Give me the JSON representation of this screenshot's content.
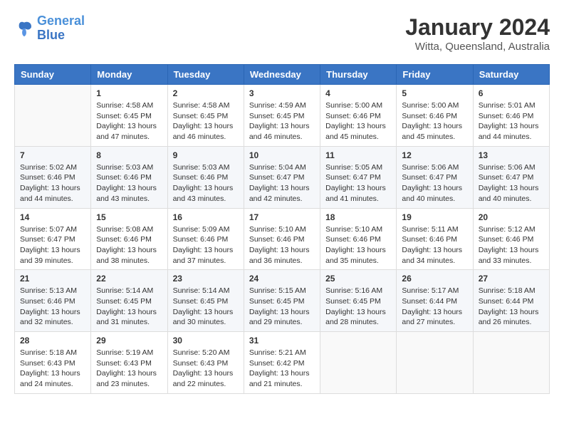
{
  "header": {
    "logo_line1": "General",
    "logo_line2": "Blue",
    "month": "January 2024",
    "location": "Witta, Queensland, Australia"
  },
  "days_of_week": [
    "Sunday",
    "Monday",
    "Tuesday",
    "Wednesday",
    "Thursday",
    "Friday",
    "Saturday"
  ],
  "weeks": [
    [
      {
        "num": "",
        "info": ""
      },
      {
        "num": "1",
        "info": "Sunrise: 4:58 AM\nSunset: 6:45 PM\nDaylight: 13 hours\nand 47 minutes."
      },
      {
        "num": "2",
        "info": "Sunrise: 4:58 AM\nSunset: 6:45 PM\nDaylight: 13 hours\nand 46 minutes."
      },
      {
        "num": "3",
        "info": "Sunrise: 4:59 AM\nSunset: 6:45 PM\nDaylight: 13 hours\nand 46 minutes."
      },
      {
        "num": "4",
        "info": "Sunrise: 5:00 AM\nSunset: 6:46 PM\nDaylight: 13 hours\nand 45 minutes."
      },
      {
        "num": "5",
        "info": "Sunrise: 5:00 AM\nSunset: 6:46 PM\nDaylight: 13 hours\nand 45 minutes."
      },
      {
        "num": "6",
        "info": "Sunrise: 5:01 AM\nSunset: 6:46 PM\nDaylight: 13 hours\nand 44 minutes."
      }
    ],
    [
      {
        "num": "7",
        "info": "Sunrise: 5:02 AM\nSunset: 6:46 PM\nDaylight: 13 hours\nand 44 minutes."
      },
      {
        "num": "8",
        "info": "Sunrise: 5:03 AM\nSunset: 6:46 PM\nDaylight: 13 hours\nand 43 minutes."
      },
      {
        "num": "9",
        "info": "Sunrise: 5:03 AM\nSunset: 6:46 PM\nDaylight: 13 hours\nand 43 minutes."
      },
      {
        "num": "10",
        "info": "Sunrise: 5:04 AM\nSunset: 6:47 PM\nDaylight: 13 hours\nand 42 minutes."
      },
      {
        "num": "11",
        "info": "Sunrise: 5:05 AM\nSunset: 6:47 PM\nDaylight: 13 hours\nand 41 minutes."
      },
      {
        "num": "12",
        "info": "Sunrise: 5:06 AM\nSunset: 6:47 PM\nDaylight: 13 hours\nand 40 minutes."
      },
      {
        "num": "13",
        "info": "Sunrise: 5:06 AM\nSunset: 6:47 PM\nDaylight: 13 hours\nand 40 minutes."
      }
    ],
    [
      {
        "num": "14",
        "info": "Sunrise: 5:07 AM\nSunset: 6:47 PM\nDaylight: 13 hours\nand 39 minutes."
      },
      {
        "num": "15",
        "info": "Sunrise: 5:08 AM\nSunset: 6:46 PM\nDaylight: 13 hours\nand 38 minutes."
      },
      {
        "num": "16",
        "info": "Sunrise: 5:09 AM\nSunset: 6:46 PM\nDaylight: 13 hours\nand 37 minutes."
      },
      {
        "num": "17",
        "info": "Sunrise: 5:10 AM\nSunset: 6:46 PM\nDaylight: 13 hours\nand 36 minutes."
      },
      {
        "num": "18",
        "info": "Sunrise: 5:10 AM\nSunset: 6:46 PM\nDaylight: 13 hours\nand 35 minutes."
      },
      {
        "num": "19",
        "info": "Sunrise: 5:11 AM\nSunset: 6:46 PM\nDaylight: 13 hours\nand 34 minutes."
      },
      {
        "num": "20",
        "info": "Sunrise: 5:12 AM\nSunset: 6:46 PM\nDaylight: 13 hours\nand 33 minutes."
      }
    ],
    [
      {
        "num": "21",
        "info": "Sunrise: 5:13 AM\nSunset: 6:46 PM\nDaylight: 13 hours\nand 32 minutes."
      },
      {
        "num": "22",
        "info": "Sunrise: 5:14 AM\nSunset: 6:45 PM\nDaylight: 13 hours\nand 31 minutes."
      },
      {
        "num": "23",
        "info": "Sunrise: 5:14 AM\nSunset: 6:45 PM\nDaylight: 13 hours\nand 30 minutes."
      },
      {
        "num": "24",
        "info": "Sunrise: 5:15 AM\nSunset: 6:45 PM\nDaylight: 13 hours\nand 29 minutes."
      },
      {
        "num": "25",
        "info": "Sunrise: 5:16 AM\nSunset: 6:45 PM\nDaylight: 13 hours\nand 28 minutes."
      },
      {
        "num": "26",
        "info": "Sunrise: 5:17 AM\nSunset: 6:44 PM\nDaylight: 13 hours\nand 27 minutes."
      },
      {
        "num": "27",
        "info": "Sunrise: 5:18 AM\nSunset: 6:44 PM\nDaylight: 13 hours\nand 26 minutes."
      }
    ],
    [
      {
        "num": "28",
        "info": "Sunrise: 5:18 AM\nSunset: 6:43 PM\nDaylight: 13 hours\nand 24 minutes."
      },
      {
        "num": "29",
        "info": "Sunrise: 5:19 AM\nSunset: 6:43 PM\nDaylight: 13 hours\nand 23 minutes."
      },
      {
        "num": "30",
        "info": "Sunrise: 5:20 AM\nSunset: 6:43 PM\nDaylight: 13 hours\nand 22 minutes."
      },
      {
        "num": "31",
        "info": "Sunrise: 5:21 AM\nSunset: 6:42 PM\nDaylight: 13 hours\nand 21 minutes."
      },
      {
        "num": "",
        "info": ""
      },
      {
        "num": "",
        "info": ""
      },
      {
        "num": "",
        "info": ""
      }
    ]
  ]
}
